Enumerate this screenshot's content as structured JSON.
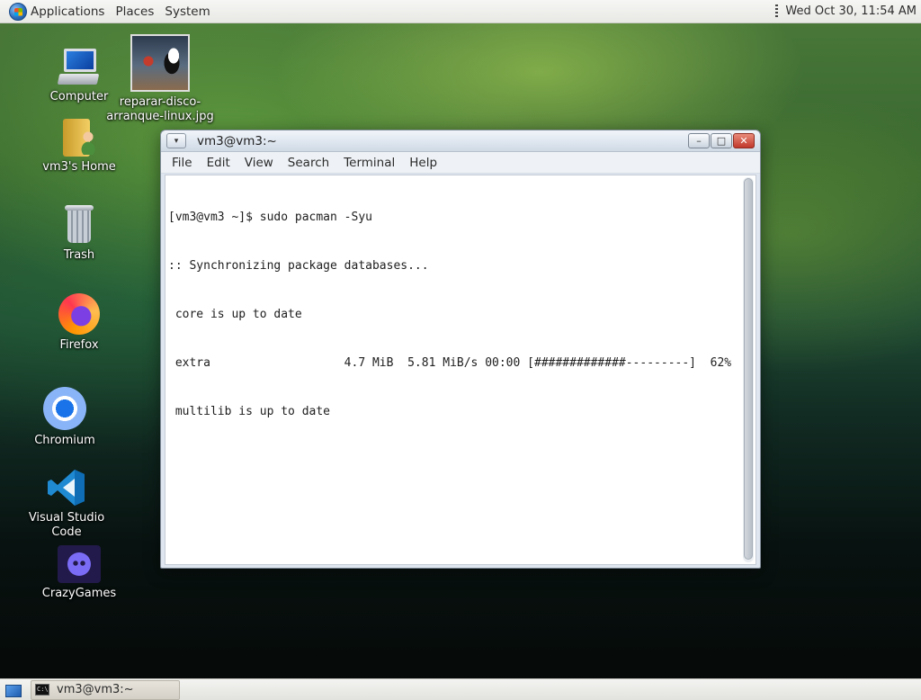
{
  "top_panel": {
    "menus": [
      "Applications",
      "Places",
      "System"
    ],
    "clock": "Wed Oct 30, 11:54 AM"
  },
  "desktop_icons": {
    "computer": "Computer",
    "image_file_line1": "reparar-disco-",
    "image_file_line2": "arranque-linux.jpg",
    "home": "vm3's Home",
    "trash": "Trash",
    "firefox": "Firefox",
    "chromium": "Chromium",
    "vscode": "Visual Studio Code",
    "crazygames": "CrazyGames"
  },
  "window": {
    "title": "vm3@vm3:~",
    "menu": [
      "File",
      "Edit",
      "View",
      "Search",
      "Terminal",
      "Help"
    ],
    "terminal_lines": [
      "[vm3@vm3 ~]$ sudo pacman -Syu",
      ":: Synchronizing package databases...",
      " core is up to date",
      " extra                   4.7 MiB  5.81 MiB/s 00:00 [#############---------]  62%",
      " multilib is up to date"
    ]
  },
  "taskbar": {
    "task_label": "vm3@vm3:~"
  }
}
